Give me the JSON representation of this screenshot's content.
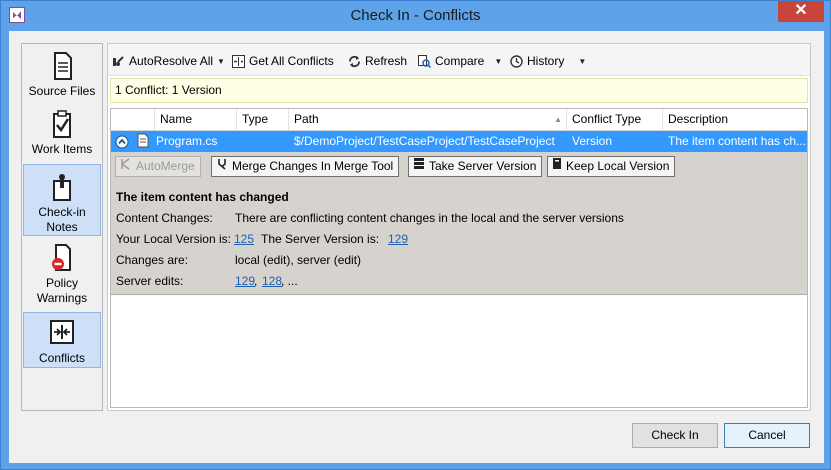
{
  "window": {
    "title": "Check In - Conflicts",
    "close_glyph": "✕"
  },
  "nav": {
    "items": [
      {
        "label": "Source Files",
        "icon": "source-files-icon",
        "active": false
      },
      {
        "label": "Work Items",
        "icon": "work-items-icon",
        "active": false
      },
      {
        "label": "Check-in Notes",
        "icon": "checkin-notes-icon",
        "active": true
      },
      {
        "label": "Policy Warnings",
        "icon": "policy-warnings-icon",
        "active": false
      },
      {
        "label": "Conflicts",
        "icon": "conflicts-icon",
        "active": true
      }
    ]
  },
  "toolbar": {
    "autoresolve": "AutoResolve All",
    "get_all": "Get All Conflicts",
    "refresh": "Refresh",
    "compare": "Compare",
    "history": "History"
  },
  "summary": "1 Conflict: 1 Version",
  "grid": {
    "columns": [
      "Name",
      "Type",
      "Path",
      "Conflict Type",
      "Description"
    ],
    "rows": [
      {
        "name": "Program.cs",
        "type": "",
        "path": "$/DemoProject/TestCaseProject/TestCaseProject",
        "conflict_type": "Version",
        "description": "The item content has ch..."
      }
    ]
  },
  "details": {
    "buttons": {
      "automerge": "AutoMerge",
      "merge_tool": "Merge Changes In Merge Tool",
      "take_server": "Take Server Version",
      "keep_local": "Keep Local Version"
    },
    "heading": "The item content has changed",
    "content_changes_label": "Content Changes:",
    "content_changes_value": "There are conflicting content changes in the local and the server versions",
    "local_version_label": "Your Local Version is:",
    "local_version": "125",
    "server_version_label": "The Server Version is:",
    "server_version": "129",
    "changes_are_label": "Changes are:",
    "changes_are_value": "local (edit), server (edit)",
    "server_edits_label": "Server edits:",
    "server_edit_1": "129",
    "server_edit_sep": ",",
    "server_edit_2": "128",
    "server_edit_more": ", ..."
  },
  "footer": {
    "check_in": "Check In",
    "cancel": "Cancel"
  },
  "colors": {
    "selection": "#3399ff",
    "details_bg": "#d6d3ce",
    "summary_bg": "#ffffe6",
    "link": "#1e5fb3"
  }
}
